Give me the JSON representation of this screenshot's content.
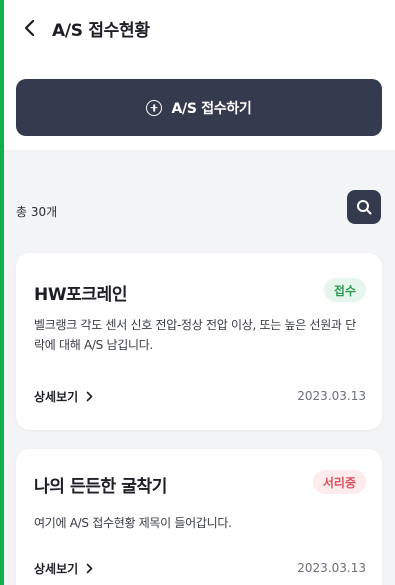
{
  "header": {
    "title": "A/S 접수현황"
  },
  "apply_button": {
    "label": "A/S 접수하기"
  },
  "list": {
    "total_label": "총 30개"
  },
  "cards": [
    {
      "title": "HW포크레인",
      "status": "접수",
      "description": "벨크랭크 각도 센서 신호 전압-정상 전압 이상, 또는 높은 선원과 단락에 대해 A/S 남깁니다.",
      "detail_label": "상세보기",
      "date": "2023.03.13"
    },
    {
      "title": "나의 든든한 굴착기",
      "status": "서리중",
      "description": "여기에 A/S 접수현황 제목이 들어갑니다.",
      "detail_label": "상세보기",
      "date": "2023.03.13"
    }
  ],
  "colors": {
    "primary_dark": "#353b4f",
    "status_received_bg": "#e7f6ec",
    "status_received_text": "#2e9a55",
    "status_processing_bg": "#fdebed",
    "status_processing_text": "#e0505c",
    "frame_green": "#0fb14b"
  },
  "icons": {
    "back": "chevron-left-icon",
    "add": "plus-circle-icon",
    "search": "search-icon",
    "detail": "chevron-right-icon"
  }
}
